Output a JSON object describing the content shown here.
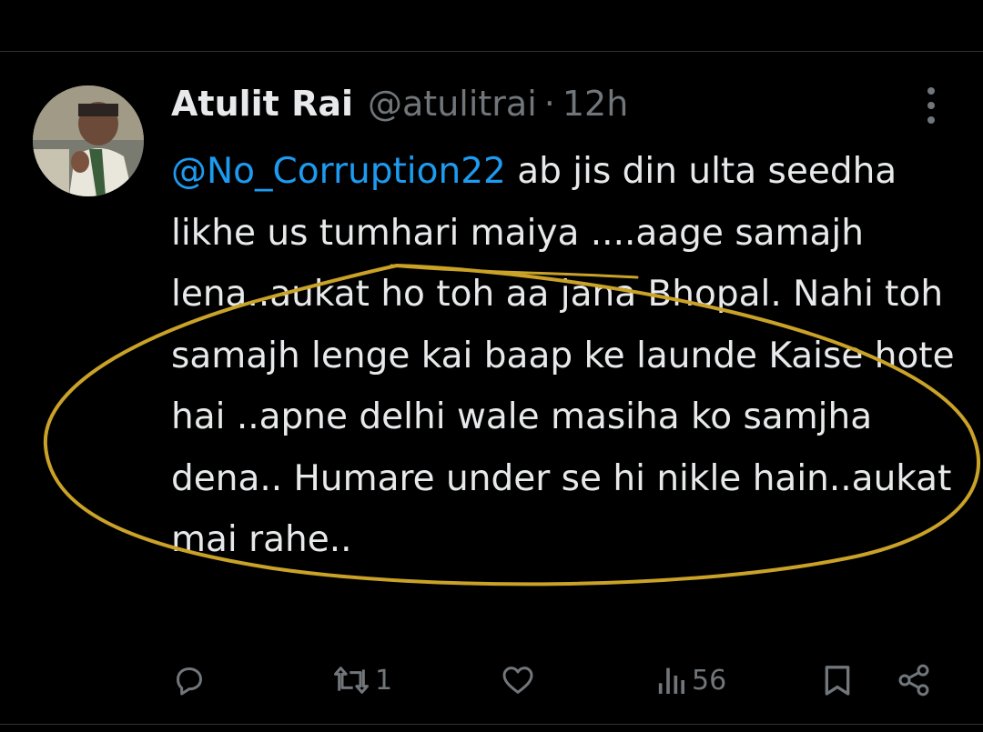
{
  "tweet": {
    "author_name": "Atulit Rai",
    "author_handle": "@atulitrai",
    "separator": "·",
    "time": "12h",
    "mention": "@No_Corruption22",
    "body_text": " ab jis din ulta seedha likhe us tumhari maiya ....aage samajh lena..aukat ho toh aa jana Bhopal. Nahi toh samajh lenge kai baap ke launde Kaise hote hai ..apne delhi wale masiha ko samjha dena.. Humare under se hi nikle hain..aukat mai rahe.."
  },
  "actions": {
    "reply_icon": "reply-icon",
    "retweet_icon": "retweet-icon",
    "retweet_count": "1",
    "like_icon": "heart-icon",
    "views_icon": "views-icon",
    "views_count": "56",
    "bookmark_icon": "bookmark-icon",
    "share_icon": "share-icon"
  },
  "colors": {
    "background": "#000000",
    "text": "#e7e9ea",
    "muted": "#71767b",
    "link": "#1d9bf0",
    "annotation": "#c9a227"
  }
}
